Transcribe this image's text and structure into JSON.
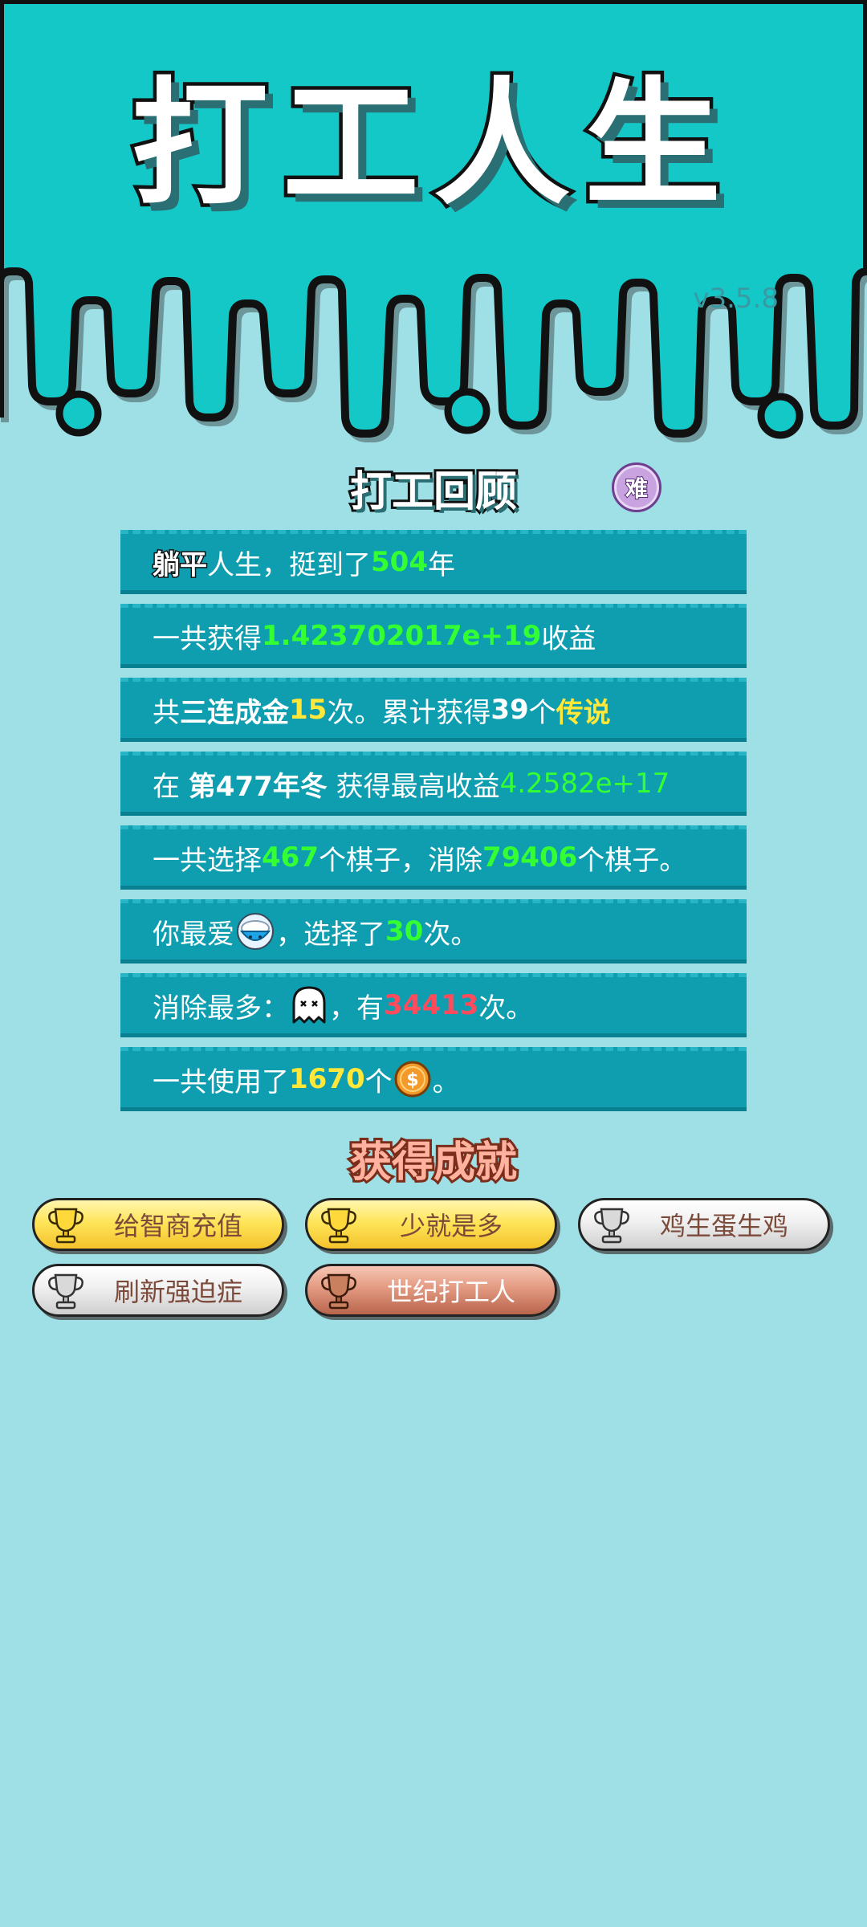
{
  "header": {
    "title": "打工人生",
    "version": "v3.5.8"
  },
  "review": {
    "title": "打工回顾",
    "difficulty": "难",
    "rows": {
      "r1": {
        "a": "躺平",
        "b": "人生，挺到了",
        "c": "504",
        "d": "年"
      },
      "r2": {
        "a": "一共获得",
        "b": "1.423702017e+19",
        "c": "收益"
      },
      "r3": {
        "a": "共",
        "b": "三连成金",
        "c": "15",
        "d": "次。累计获得",
        "e": "39",
        "f": "个",
        "g": "传说"
      },
      "r4": {
        "a": "在 ",
        "b": "第477年冬",
        "c": " 获得最高收益",
        "d": "4.2582e+17"
      },
      "r5": {
        "a": "一共选择",
        "b": "467",
        "c": "个棋子，消除",
        "d": "79406",
        "e": "个棋子。"
      },
      "r6": {
        "a": "你最爱",
        "icon": "rice-bowl-icon",
        "b": "，选择了",
        "c": "30",
        "d": "次。"
      },
      "r7": {
        "a": "消除最多：",
        "icon": "ghost-icon",
        "b": "，有",
        "c": "34413",
        "d": "次。"
      },
      "r8": {
        "a": "一共使用了",
        "b": "1670",
        "c": "个",
        "icon": "coin-icon",
        "d": "。"
      }
    }
  },
  "achievements": {
    "title": "获得成就",
    "items": [
      {
        "label": "给智商充值",
        "tier": "gold"
      },
      {
        "label": "少就是多",
        "tier": "gold"
      },
      {
        "label": "鸡生蛋生鸡",
        "tier": "silver"
      },
      {
        "label": "刷新强迫症",
        "tier": "silver"
      },
      {
        "label": "世纪打工人",
        "tier": "bronze"
      }
    ]
  },
  "colors": {
    "top": "#14c8c8",
    "background": "#9fdfe6",
    "row": "#0f9eb0",
    "green": "#33ff33",
    "yellow": "#ffe83a",
    "red": "#ff4b5c"
  }
}
